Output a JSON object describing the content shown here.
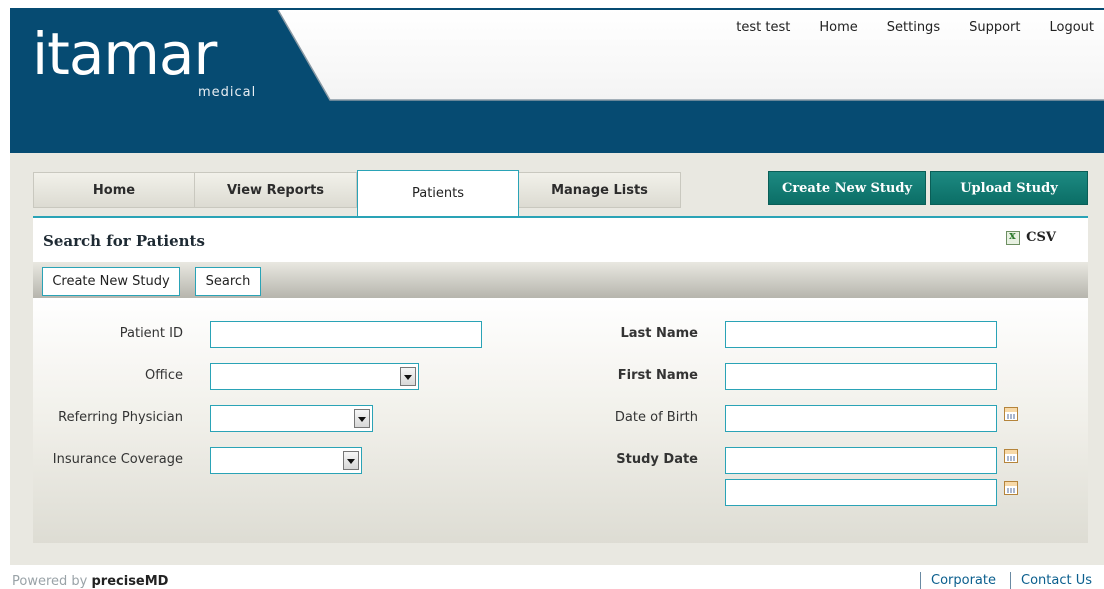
{
  "header": {
    "logo_main": "itamar",
    "logo_sub": "medical",
    "user": "test test",
    "links": [
      "Home",
      "Settings",
      "Support",
      "Logout"
    ]
  },
  "nav": {
    "tabs": [
      "Home",
      "View Reports",
      "Patients",
      "Manage Lists"
    ],
    "active_tab": "Patients",
    "create_new_study": "Create New Study",
    "upload_study": "Upload Study"
  },
  "panel": {
    "title": "Search for Patients",
    "csv_label": "CSV",
    "toolbar": {
      "create_new_study": "Create New Study",
      "search": "Search"
    },
    "fields": {
      "patient_id": "Patient ID",
      "office": "Office",
      "referring_physician": "Referring Physician",
      "insurance_coverage": "Insurance Coverage",
      "last_name": "Last Name",
      "first_name": "First Name",
      "date_of_birth": "Date of Birth",
      "study_date": "Study Date"
    }
  },
  "footer": {
    "powered_prefix": "Powered by",
    "powered_brand": "preciseMD",
    "links": [
      "Corporate",
      "Contact Us"
    ]
  },
  "colors": {
    "header_blue": "#064b72",
    "accent_teal": "#2aa3b6",
    "button_green": "#0b6e66"
  }
}
